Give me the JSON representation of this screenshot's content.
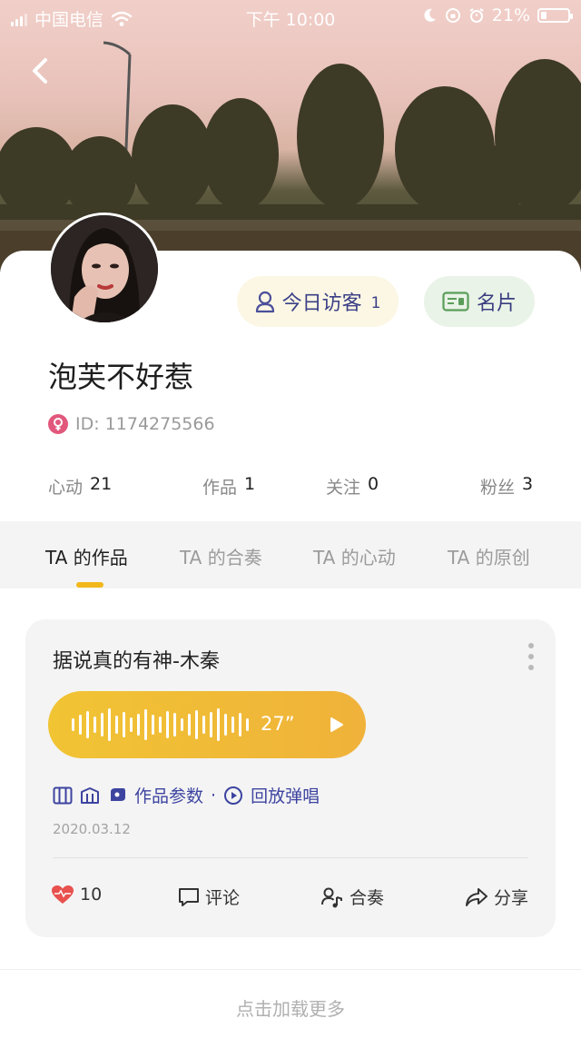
{
  "status_bar": {
    "carrier": "中国电信",
    "time": "下午 10:00",
    "battery_text": "21%",
    "battery_level": 0.21
  },
  "profile": {
    "visitors_label": "今日访客",
    "visitors_count": "1",
    "card_label": "名片",
    "nickname": "泡芙不好惹",
    "id_text": "ID: 1174275566",
    "gender": "female",
    "stats": [
      {
        "label": "心动",
        "value": "21"
      },
      {
        "label": "作品",
        "value": "1"
      },
      {
        "label": "关注",
        "value": "0"
      },
      {
        "label": "粉丝",
        "value": "3"
      }
    ]
  },
  "tabs": [
    {
      "label": "TA 的作品",
      "active": true
    },
    {
      "label": "TA 的合奏",
      "active": false
    },
    {
      "label": "TA 的心动",
      "active": false
    },
    {
      "label": "TA 的原创",
      "active": false
    }
  ],
  "work": {
    "title": "据说真的有神-木秦",
    "duration": "27”",
    "params_label": "作品参数",
    "separator": "·",
    "replay_label": "回放弹唱",
    "date": "2020.03.12",
    "likes": "10",
    "comment_label": "评论",
    "ensemble_label": "合奏",
    "share_label": "分享"
  },
  "load_more": "点击加载更多",
  "colors": {
    "accent_yellow": "#f2b81b",
    "link_blue": "#3d44a0",
    "heart_red": "#e8514e",
    "visit_bg": "#fbf7e4",
    "card_bg": "#e9f3e7"
  }
}
